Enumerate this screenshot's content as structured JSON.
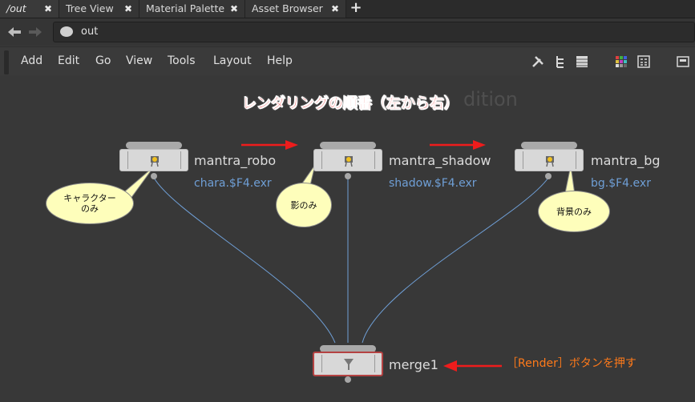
{
  "tabs": [
    {
      "label": "/out",
      "close": "✖"
    },
    {
      "label": "Tree View",
      "close": "✖"
    },
    {
      "label": "Material Palette",
      "close": "✖"
    },
    {
      "label": "Asset Browser",
      "close": "✖"
    }
  ],
  "add_tab": "+",
  "path": {
    "value": "out"
  },
  "menu": [
    "Add",
    "Edit",
    "Go",
    "View",
    "Tools",
    "Layout",
    "Help"
  ],
  "canvas": {
    "ghost_label": "dition",
    "title": "レンダリングの順番（左から右）",
    "nodes": [
      {
        "name": "mantra_robo",
        "output": "chara.$F4.exr"
      },
      {
        "name": "mantra_shadow",
        "output": "shadow.$F4.exr"
      },
      {
        "name": "mantra_bg",
        "output": "bg.$F4.exr"
      },
      {
        "name": "merge1"
      }
    ],
    "bubbles": [
      {
        "line1": "キャラクター",
        "line2": "のみ"
      },
      {
        "line1": "影のみ"
      },
      {
        "line1": "背景のみ"
      }
    ],
    "callout": "［Render］ボタンを押す"
  },
  "colors": {
    "accent_red": "#ee1c1c",
    "wire_blue": "#6f9fd6",
    "callout_orange": "#ff7a1a"
  }
}
